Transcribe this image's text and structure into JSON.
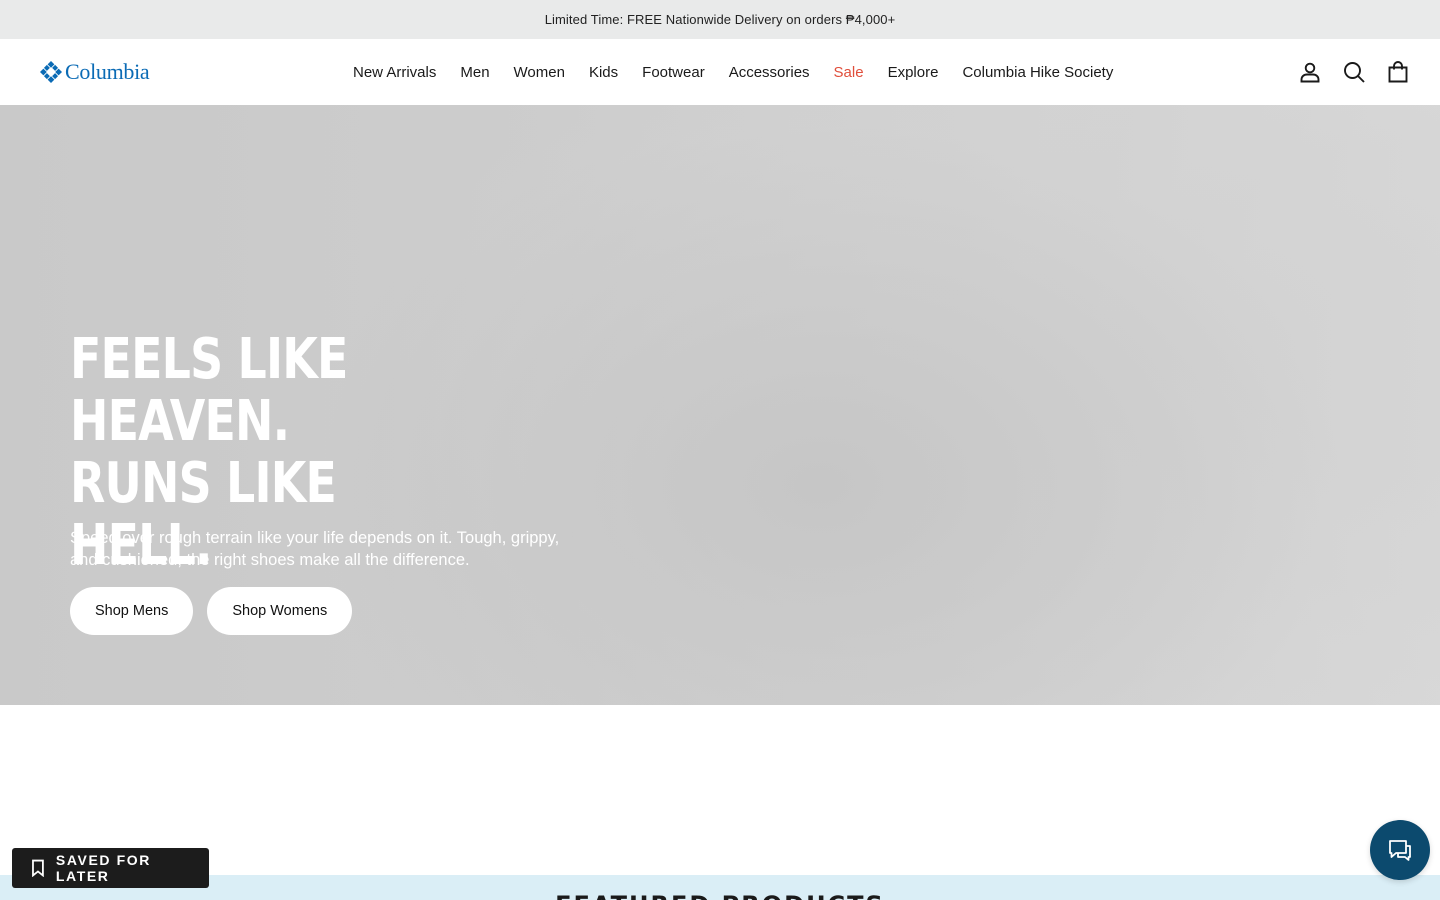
{
  "announcement": {
    "text": "Limited Time: FREE Nationwide Delivery on orders ₱4,000+"
  },
  "header": {
    "logo_text": "Columbia",
    "brand_color": "#0b6bb5",
    "nav": [
      {
        "label": "New Arrivals"
      },
      {
        "label": "Men"
      },
      {
        "label": "Women"
      },
      {
        "label": "Kids"
      },
      {
        "label": "Footwear"
      },
      {
        "label": "Accessories"
      },
      {
        "label": "Sale",
        "color": "#e04e3b"
      },
      {
        "label": "Explore"
      },
      {
        "label": "Columbia Hike Society"
      }
    ],
    "icons": [
      "account-icon",
      "search-icon",
      "cart-icon"
    ]
  },
  "hero": {
    "title": "Feels like heaven. Runs like hell.",
    "subtitle": "Speed over rough terrain like your life depends on it. Tough, grippy, and cushioned, the right shoes make all the difference.",
    "buttons": [
      {
        "label": "Shop Mens"
      },
      {
        "label": "Shop Womens"
      }
    ]
  },
  "featured": {
    "title": "FEATURED PRODUCTS"
  },
  "saved_for_later": {
    "label": "SAVED FOR LATER",
    "icon": "bookmark-icon"
  },
  "chat": {
    "icon": "chat-icon",
    "color": "#0c4a6e"
  }
}
